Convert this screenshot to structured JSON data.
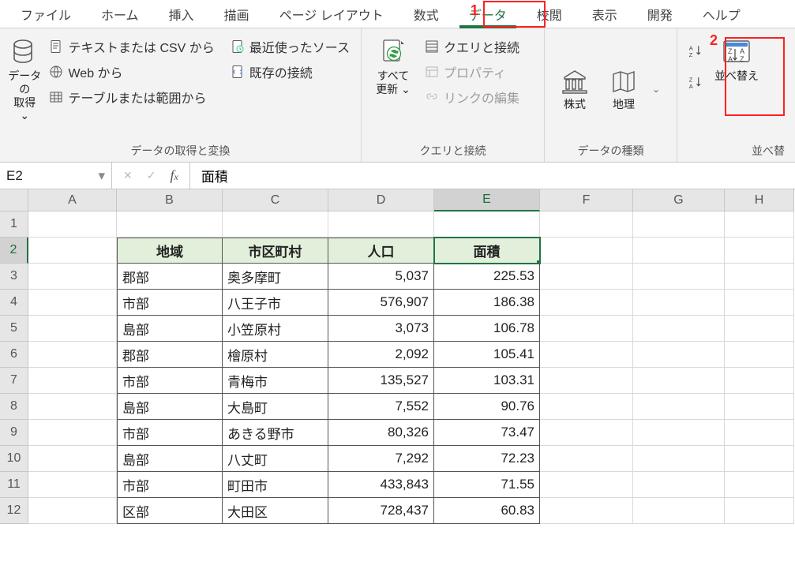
{
  "tabs": [
    "ファイル",
    "ホーム",
    "挿入",
    "描画",
    "ページ レイアウト",
    "数式",
    "データ",
    "校閲",
    "表示",
    "開発",
    "ヘルプ"
  ],
  "active_tab_index": 6,
  "ribbon": {
    "get_transform": {
      "get_data": {
        "l1": "データの",
        "l2": "取得"
      },
      "from_text_csv": "テキストまたは CSV から",
      "from_web": "Web から",
      "from_table_range": "テーブルまたは範囲から",
      "recent_sources": "最近使ったソース",
      "existing_connections": "既存の接続",
      "group_label": "データの取得と変換"
    },
    "queries": {
      "refresh_all": {
        "l1": "すべて",
        "l2": "更新"
      },
      "queries_conn": "クエリと接続",
      "properties": "プロパティ",
      "edit_links": "リンクの編集",
      "group_label": "クエリと接続"
    },
    "data_types": {
      "stocks": "株式",
      "geography": "地理",
      "group_label": "データの種類"
    },
    "sort_filter": {
      "sort": "並べ替え",
      "group_label": "並べ替"
    }
  },
  "annotations": {
    "one": "1",
    "two": "2"
  },
  "name_box": "E2",
  "formula_bar": "面積",
  "columns": [
    "A",
    "B",
    "C",
    "D",
    "E",
    "F",
    "G",
    "H"
  ],
  "selected_col_index": 4,
  "selected_row_index": 1,
  "headers": [
    "地域",
    "市区町村",
    "人口",
    "面積"
  ],
  "rows": [
    {
      "b": "郡部",
      "c": "奥多摩町",
      "d": "5,037",
      "e": "225.53"
    },
    {
      "b": "市部",
      "c": "八王子市",
      "d": "576,907",
      "e": "186.38"
    },
    {
      "b": "島部",
      "c": "小笠原村",
      "d": "3,073",
      "e": "106.78"
    },
    {
      "b": "郡部",
      "c": "檜原村",
      "d": "2,092",
      "e": "105.41"
    },
    {
      "b": "市部",
      "c": "青梅市",
      "d": "135,527",
      "e": "103.31"
    },
    {
      "b": "島部",
      "c": "大島町",
      "d": "7,552",
      "e": "90.76"
    },
    {
      "b": "市部",
      "c": "あきる野市",
      "d": "80,326",
      "e": "73.47"
    },
    {
      "b": "島部",
      "c": "八丈町",
      "d": "7,292",
      "e": "72.23"
    },
    {
      "b": "市部",
      "c": "町田市",
      "d": "433,843",
      "e": "71.55"
    },
    {
      "b": "区部",
      "c": "大田区",
      "d": "728,437",
      "e": "60.83"
    }
  ],
  "chart_data": {
    "type": "table",
    "title": "",
    "columns": [
      "地域",
      "市区町村",
      "人口",
      "面積"
    ],
    "rows": [
      [
        "郡部",
        "奥多摩町",
        5037,
        225.53
      ],
      [
        "市部",
        "八王子市",
        576907,
        186.38
      ],
      [
        "島部",
        "小笠原村",
        3073,
        106.78
      ],
      [
        "郡部",
        "檜原村",
        2092,
        105.41
      ],
      [
        "市部",
        "青梅市",
        135527,
        103.31
      ],
      [
        "島部",
        "大島町",
        7552,
        90.76
      ],
      [
        "市部",
        "あきる野市",
        80326,
        73.47
      ],
      [
        "島部",
        "八丈町",
        7292,
        72.23
      ],
      [
        "市部",
        "町田市",
        433843,
        71.55
      ],
      [
        "区部",
        "大田区",
        728437,
        60.83
      ]
    ]
  }
}
